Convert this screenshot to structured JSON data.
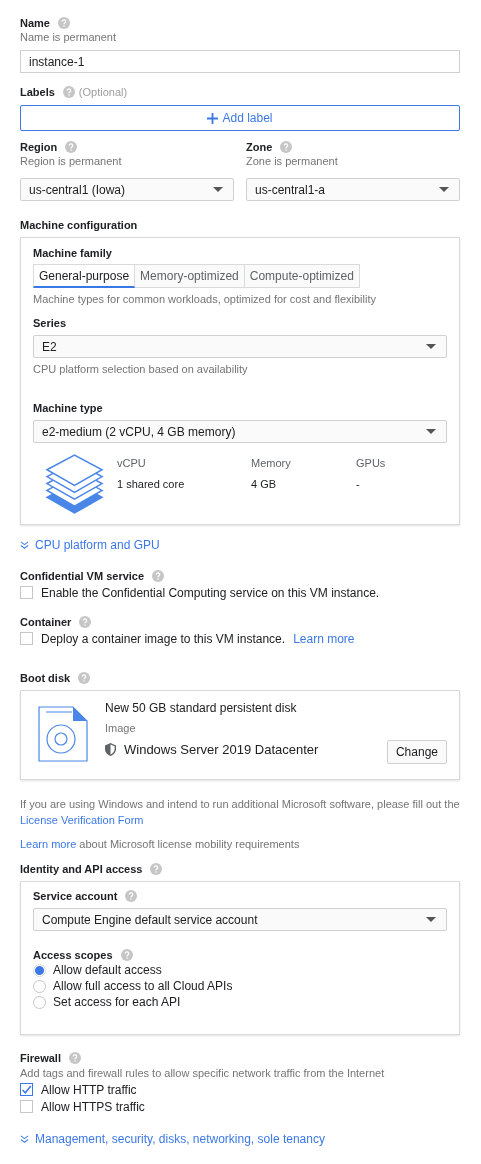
{
  "name": {
    "label": "Name",
    "hint": "Name is permanent",
    "value": "instance-1"
  },
  "labels": {
    "label": "Labels",
    "optional": "(Optional)",
    "button": "Add label"
  },
  "region": {
    "label": "Region",
    "hint": "Region is permanent",
    "value": "us-central1 (Iowa)"
  },
  "zone": {
    "label": "Zone",
    "hint": "Zone is permanent",
    "value": "us-central1-a"
  },
  "machine_configuration": {
    "title": "Machine configuration",
    "family_label": "Machine family",
    "tabs": [
      {
        "label": "General-purpose",
        "selected": true
      },
      {
        "label": "Memory-optimized",
        "selected": false
      },
      {
        "label": "Compute-optimized",
        "selected": false
      }
    ],
    "family_description": "Machine types for common workloads, optimized for cost and flexibility",
    "series": {
      "label": "Series",
      "value": "E2",
      "hint": "CPU platform selection based on availability"
    },
    "machine_type": {
      "label": "Machine type",
      "value": "e2-medium (2 vCPU, 4 GB memory)"
    },
    "specs": [
      {
        "heading": "vCPU",
        "value": "1 shared core"
      },
      {
        "heading": "Memory",
        "value": "4 GB"
      },
      {
        "heading": "GPUs",
        "value": "-"
      }
    ]
  },
  "cpu_platform_link": "CPU platform and GPU",
  "confidential_vm": {
    "label": "Confidential VM service",
    "option": {
      "text": "Enable the Confidential Computing service on this VM instance.",
      "checked": false
    }
  },
  "container": {
    "label": "Container",
    "option": {
      "text": "Deploy a container image to this VM instance.",
      "link": "Learn more",
      "checked": false
    }
  },
  "boot_disk": {
    "label": "Boot disk",
    "disk": "New 50 GB standard persistent disk",
    "image_label": "Image",
    "image": "Windows Server 2019 Datacenter",
    "button": "Change"
  },
  "license_note": {
    "text": "If you are using Windows and intend to run additional Microsoft software, please fill out the",
    "link": "License Verification Form"
  },
  "mobility_note": {
    "link": "Learn more",
    "text": "about Microsoft license mobility requirements"
  },
  "identity": {
    "label": "Identity and API access",
    "service_account": {
      "label": "Service account",
      "value": "Compute Engine default service account"
    },
    "access_scopes": {
      "label": "Access scopes",
      "options": [
        {
          "text": "Allow default access",
          "selected": true
        },
        {
          "text": "Allow full access to all Cloud APIs",
          "selected": false
        },
        {
          "text": "Set access for each API",
          "selected": false
        }
      ]
    }
  },
  "firewall": {
    "label": "Firewall",
    "hint": "Add tags and firewall rules to allow specific network traffic from the Internet",
    "options": [
      {
        "text": "Allow HTTP traffic",
        "checked": true
      },
      {
        "text": "Allow HTTPS traffic",
        "checked": false
      }
    ]
  },
  "management_link": "Management, security, disks, networking, sole tenancy"
}
